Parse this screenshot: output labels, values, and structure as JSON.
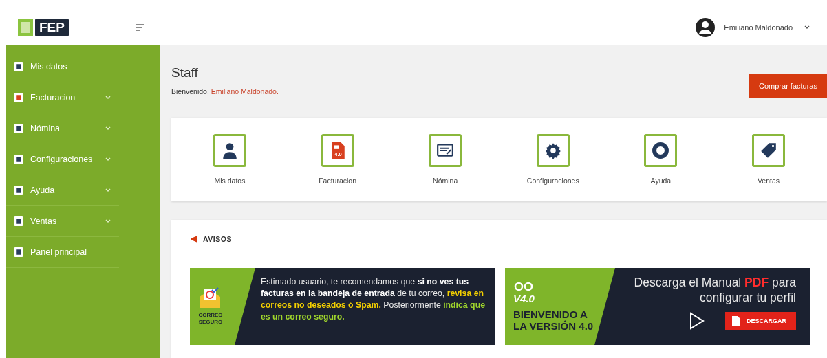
{
  "logo": {
    "text": "FEP"
  },
  "sidebar": {
    "items": [
      {
        "label": "Mis datos",
        "kind": "user",
        "has_submenu": false
      },
      {
        "label": "Facturacion",
        "kind": "invoice",
        "has_submenu": true
      },
      {
        "label": "Nómina",
        "kind": "payroll",
        "has_submenu": true
      },
      {
        "label": "Configuraciones",
        "kind": "gear",
        "has_submenu": true
      },
      {
        "label": "Ayuda",
        "kind": "lifebuoy",
        "has_submenu": true
      },
      {
        "label": "Ventas",
        "kind": "tag",
        "has_submenu": true
      },
      {
        "label": "Panel principal",
        "kind": "monitor",
        "has_submenu": false
      }
    ]
  },
  "header": {
    "user_name": "Emiliano Maldonado"
  },
  "page": {
    "title": "Staff",
    "welcome": "Bienvenido,",
    "welcome_name": "Emiliano Maldonado.",
    "buy_button": "Comprar facturas"
  },
  "shortcuts": [
    {
      "label": "Mis datos",
      "kind": "user"
    },
    {
      "label": "Facturacion",
      "kind": "invoice",
      "icon_text": "4.0"
    },
    {
      "label": "Nómina",
      "kind": "payroll"
    },
    {
      "label": "Configuraciones",
      "kind": "gear"
    },
    {
      "label": "Ayuda",
      "kind": "lifebuoy"
    },
    {
      "label": "Ventas",
      "kind": "tag"
    }
  ],
  "notices": {
    "title": "AVISOS",
    "banners": [
      {
        "kind": "mail",
        "badge": "CORREO SEGURO",
        "segments": [
          {
            "text": "Estimado usuario, te recomendamos que ",
            "kind": "plain"
          },
          {
            "text": "si no ves tus facturas en la bandeja de entrada",
            "kind": "bold"
          },
          {
            "text": " de tu correo, ",
            "kind": "plain"
          },
          {
            "text": "revisa en correos no deseados ó Spam.",
            "kind": "yellow"
          },
          {
            "text": " Posteriormente ",
            "kind": "plain"
          },
          {
            "text": "indica que es un correo seguro.",
            "kind": "green"
          }
        ]
      },
      {
        "kind": "manual",
        "logo": "V4.0",
        "welcome": "BIENVENIDO A LA VERSIÓN 4.0",
        "segments": [
          {
            "text": "Descarga el Manual ",
            "kind": "plain"
          },
          {
            "text": "PDF",
            "kind": "red"
          },
          {
            "text": " para configurar tu perfil",
            "kind": "plain"
          }
        ],
        "button": "DESCARGAR"
      }
    ]
  }
}
